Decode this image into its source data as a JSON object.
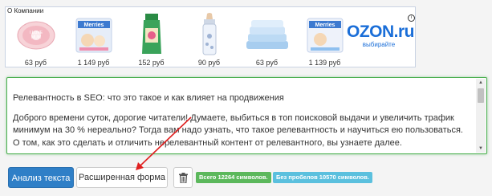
{
  "ad": {
    "label": "О Компании",
    "info_icon": "info-icon",
    "items": [
      {
        "price": "63 руб",
        "icon": "pacifier"
      },
      {
        "price": "1 149 руб",
        "icon": "diapers-pack"
      },
      {
        "price": "152 руб",
        "icon": "cream-tube"
      },
      {
        "price": "90 руб",
        "icon": "baby-bottle"
      },
      {
        "price": "63 руб",
        "icon": "towels"
      },
      {
        "price": "1 139 руб",
        "icon": "diapers-pack"
      }
    ],
    "brand": {
      "logo": "OZON.ru",
      "tagline": "выбирайте"
    }
  },
  "editor": {
    "title": "Релевантность в SEO: что это такое и как влияет на продвижения",
    "body_part1": "Доброго времени суток, дорогие читатели! Думаете, выбиться в топ поисковой выдачи и увеличить трафик минимум на 30 % нереально? Тогда вам надо узнать, что такое релевантность и научиться ею пользоваться. О том, как это сделать и отличить нерелевантный контент от релевантного, вы узнаете далее.",
    "border_color": "#4caf50"
  },
  "buttons": {
    "analyze": "Анализ текста",
    "extended": "Расширенная форма",
    "clear_icon": "trash-icon"
  },
  "badges": {
    "total": "Всего 12264 символов.",
    "no_spaces": "Без пробелов 10570 символов."
  },
  "colors": {
    "primary": "#2f7fc7",
    "badge_green": "#5cb85c",
    "badge_blue": "#5bc0de",
    "arrow": "#e02020"
  }
}
